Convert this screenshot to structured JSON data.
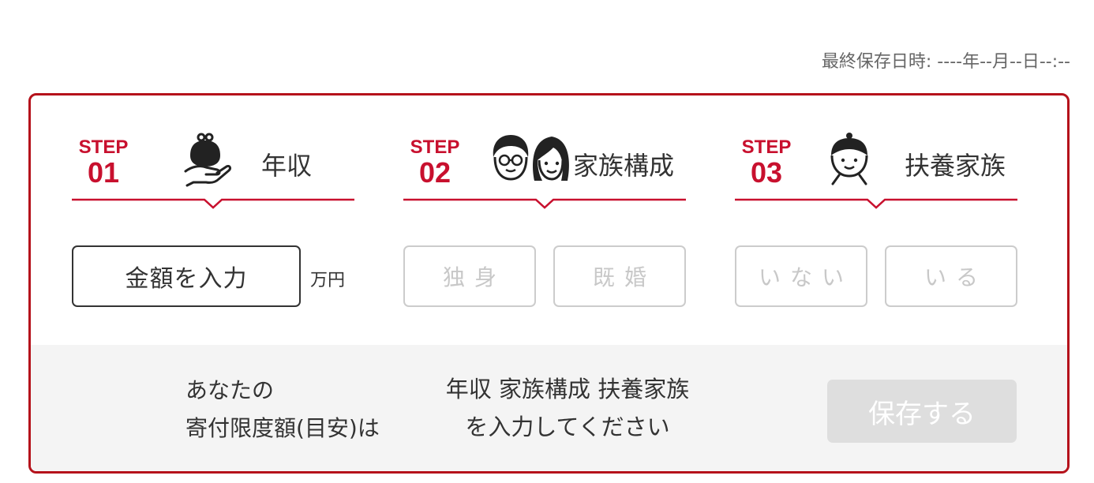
{
  "header": {
    "last_saved": "最終保存日時: ----年--月--日--:--"
  },
  "steps": [
    {
      "step_word": "STEP",
      "number": "01",
      "title": "年収",
      "icon": "coin-purse-hand-icon"
    },
    {
      "step_word": "STEP",
      "number": "02",
      "title": "家族構成",
      "icon": "couple-icon"
    },
    {
      "step_word": "STEP",
      "number": "03",
      "title": "扶養家族",
      "icon": "child-icon"
    }
  ],
  "income": {
    "button_label": "金額を入力",
    "unit": "万円"
  },
  "family": {
    "options": [
      "独身",
      "既婚"
    ]
  },
  "dependents": {
    "options": [
      "いない",
      "いる"
    ]
  },
  "result": {
    "label_line1": "あなたの",
    "label_line2": "寄付限度額(目安)は",
    "message_line1": "年収 家族構成 扶養家族",
    "message_line2": "を入力してください"
  },
  "save_button": "保存する",
  "colors": {
    "accent": "#c8102e",
    "border": "#b5121b",
    "footer_bg": "#f4f4f4",
    "disabled_button": "#dedede"
  }
}
